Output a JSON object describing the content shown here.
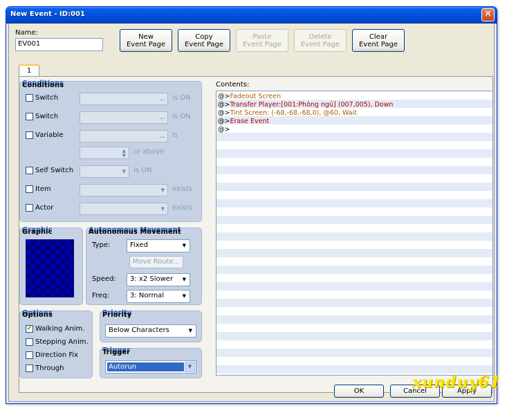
{
  "window": {
    "title": "New Event - ID:001"
  },
  "name": {
    "label": "Name:",
    "value": "EV001"
  },
  "toolbar": {
    "new_page": "New\nEvent Page",
    "copy_page": "Copy\nEvent Page",
    "paste_page": "Paste\nEvent Page",
    "delete_page": "Delete\nEvent Page",
    "clear_page": "Clear\nEvent Page"
  },
  "tabs": [
    {
      "label": "1"
    }
  ],
  "conditions": {
    "title": "Conditions",
    "switch1": {
      "label": "Switch",
      "suffix": "is ON"
    },
    "switch2": {
      "label": "Switch",
      "suffix": "is ON"
    },
    "variable": {
      "label": "Variable",
      "suffix": "is",
      "above": "or above"
    },
    "self_switch": {
      "label": "Self Switch",
      "suffix": "is ON"
    },
    "item": {
      "label": "Item",
      "suffix": "exists"
    },
    "actor": {
      "label": "Actor",
      "suffix": "exists"
    }
  },
  "graphic": {
    "title": "Graphic"
  },
  "movement": {
    "title": "Autonomous Movement",
    "type_label": "Type:",
    "type_value": "Fixed",
    "move_route": "Move Route...",
    "speed_label": "Speed:",
    "speed_value": "3: x2 Slower",
    "freq_label": "Freq:",
    "freq_value": "3: Normal"
  },
  "options": {
    "title": "Options",
    "walking": {
      "label": "Walking Anim.",
      "checked": true
    },
    "stepping": {
      "label": "Stepping Anim.",
      "checked": false
    },
    "direction": {
      "label": "Direction Fix",
      "checked": false
    },
    "through": {
      "label": "Through",
      "checked": false
    }
  },
  "priority": {
    "title": "Priority",
    "value": "Below Characters"
  },
  "trigger": {
    "title": "Trigger",
    "value": "Autorun"
  },
  "contents": {
    "label": "Contents:",
    "marker": "@>",
    "lines": [
      "Fadeout Screen",
      "Transfer Player:[001:Phòng ngủ] (007,005), Down",
      "Tint Screen: (-68,-68,-68,0), @60, Wait",
      "Erase Event",
      ""
    ]
  },
  "footer": {
    "ok": "OK",
    "cancel": "Cancel",
    "apply": "Apply"
  },
  "watermark": "xunduy61"
}
